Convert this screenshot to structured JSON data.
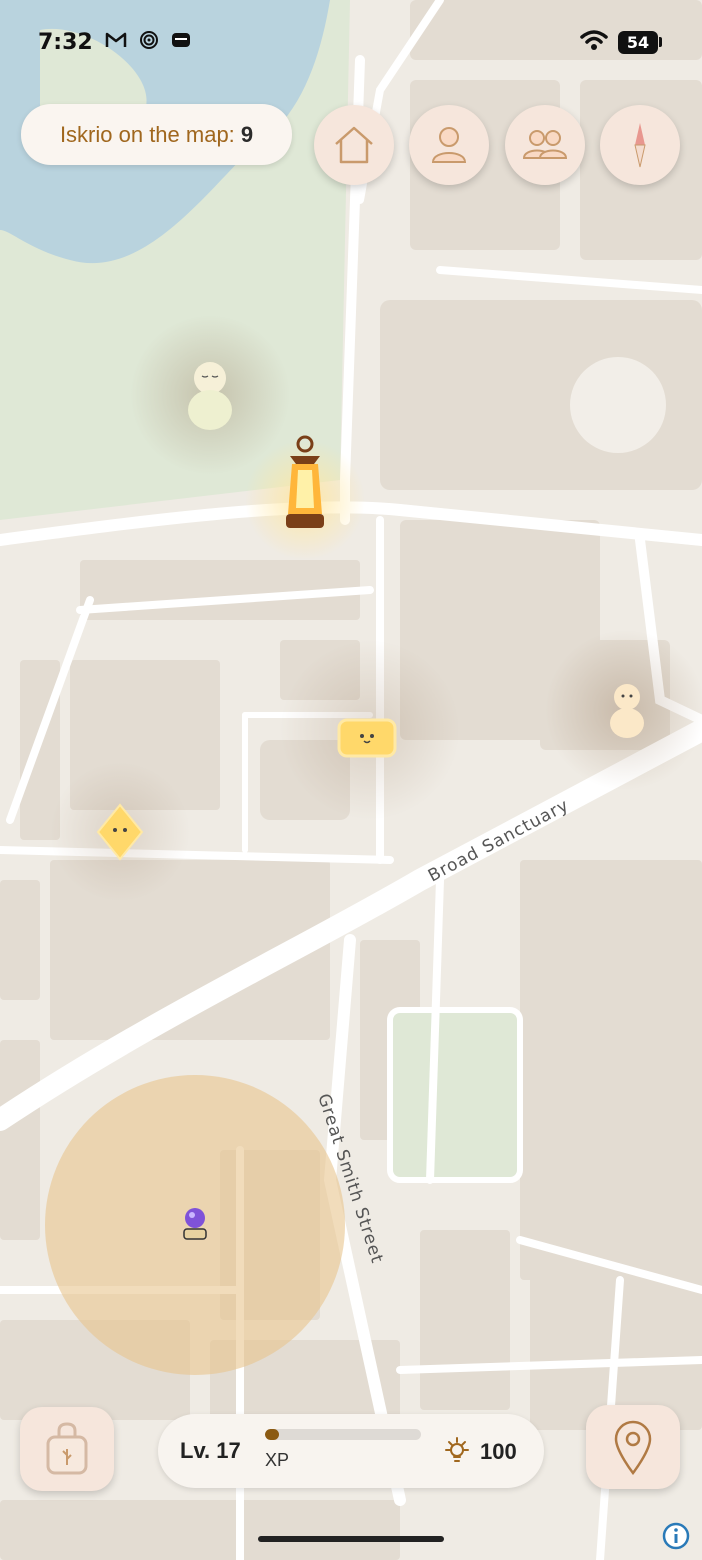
{
  "status_bar": {
    "time": "7:32",
    "battery": "54"
  },
  "counter": {
    "label": "Iskrio on the map:",
    "value": "9"
  },
  "top_buttons": [
    {
      "name": "home-button",
      "icon": "house-icon"
    },
    {
      "name": "profile-button",
      "icon": "person-icon"
    },
    {
      "name": "friends-button",
      "icon": "people-icon"
    },
    {
      "name": "compass-button",
      "icon": "compass-icon"
    }
  ],
  "map": {
    "streets": [
      "Broad Sanctuary",
      "Great Smith Street"
    ]
  },
  "player": {
    "level_label": "Lv. 17",
    "xp_label": "XP",
    "xp_progress": 0.09,
    "coins": "100"
  },
  "colors": {
    "accent": "#a0671e",
    "button_bg": "#f6e6dc",
    "xp_fill": "#8b5a12"
  }
}
